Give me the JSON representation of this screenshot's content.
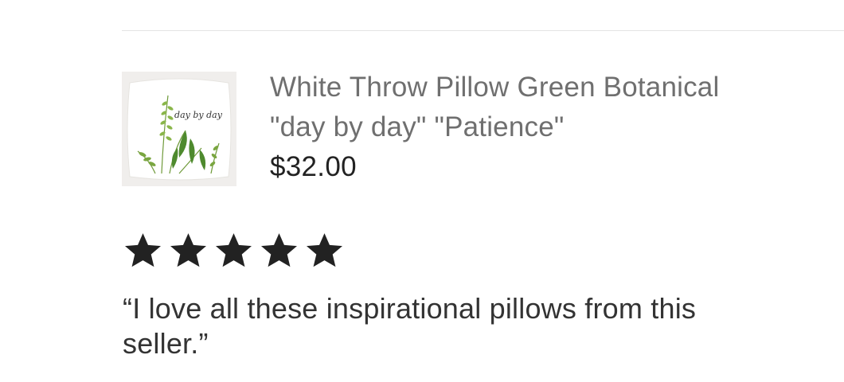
{
  "product": {
    "title": "White Throw Pillow Green Botanical \"day by day\" \"Patience\"",
    "price": "$32.00",
    "image_caption_text": "day by day",
    "image_alt": "White throw pillow with green botanical ferns"
  },
  "rating": {
    "stars": 5,
    "max": 5,
    "color": "#222222"
  },
  "review": {
    "text": "“I love all these inspirational pillows from this seller.”"
  },
  "colors": {
    "title": "#6f6f6f",
    "price": "#222222",
    "review": "#333333",
    "divider": "#e4e4e4"
  }
}
